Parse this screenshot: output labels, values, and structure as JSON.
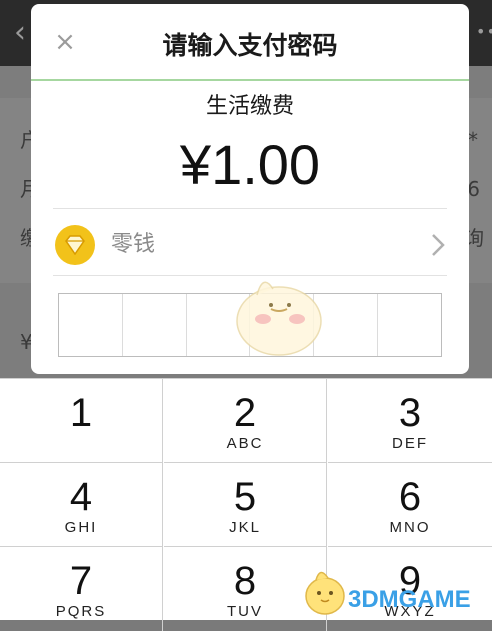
{
  "background": {
    "rows": [
      {
        "left_text": "户",
        "right_text": "*"
      },
      {
        "left_text": "月",
        "right_text": "6"
      },
      {
        "left_text": "缴",
        "right_text": "询"
      },
      {
        "left_text": "¥",
        "right_text": ""
      }
    ]
  },
  "dialog": {
    "title": "请输入支付密码",
    "close_icon": "×",
    "payment_type": "生活缴费",
    "amount": "¥1.00",
    "payment_method": "零钱",
    "pin_length": 6
  },
  "keypad": {
    "keys": [
      {
        "number": "1",
        "letters": ""
      },
      {
        "number": "2",
        "letters": "ABC"
      },
      {
        "number": "3",
        "letters": "DEF"
      },
      {
        "number": "4",
        "letters": "GHI"
      },
      {
        "number": "5",
        "letters": "JKL"
      },
      {
        "number": "6",
        "letters": "MNO"
      },
      {
        "number": "7",
        "letters": "PQRS"
      },
      {
        "number": "8",
        "letters": "TUV"
      },
      {
        "number": "9",
        "letters": "WXYZ"
      }
    ]
  },
  "watermark": {
    "text": "3DMGAME"
  },
  "colors": {
    "accent_green": "#a6d7a0",
    "coin": "#f2c21a",
    "watermark": "#3aa0e6"
  }
}
